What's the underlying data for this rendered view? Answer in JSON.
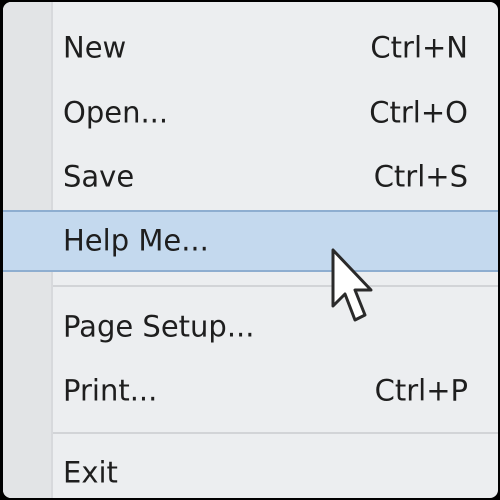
{
  "menu": {
    "items": [
      {
        "label": "New",
        "shortcut": "Ctrl+N"
      },
      {
        "label": "Open...",
        "shortcut": "Ctrl+O"
      },
      {
        "label": "Save",
        "shortcut": "Ctrl+S"
      },
      {
        "label": "Help Me...",
        "shortcut": ""
      },
      {
        "label": "Page Setup...",
        "shortcut": ""
      },
      {
        "label": "Print...",
        "shortcut": "Ctrl+P"
      },
      {
        "label": "Exit",
        "shortcut": ""
      }
    ],
    "highlighted_item": "Help Me...",
    "cursor_icon": "arrow-pointer-icon",
    "colors": {
      "menu_background": "#eceef0",
      "highlight_background": "#c4d9ee",
      "highlight_border": "#8eaed0",
      "text": "#1e1e1e"
    }
  }
}
